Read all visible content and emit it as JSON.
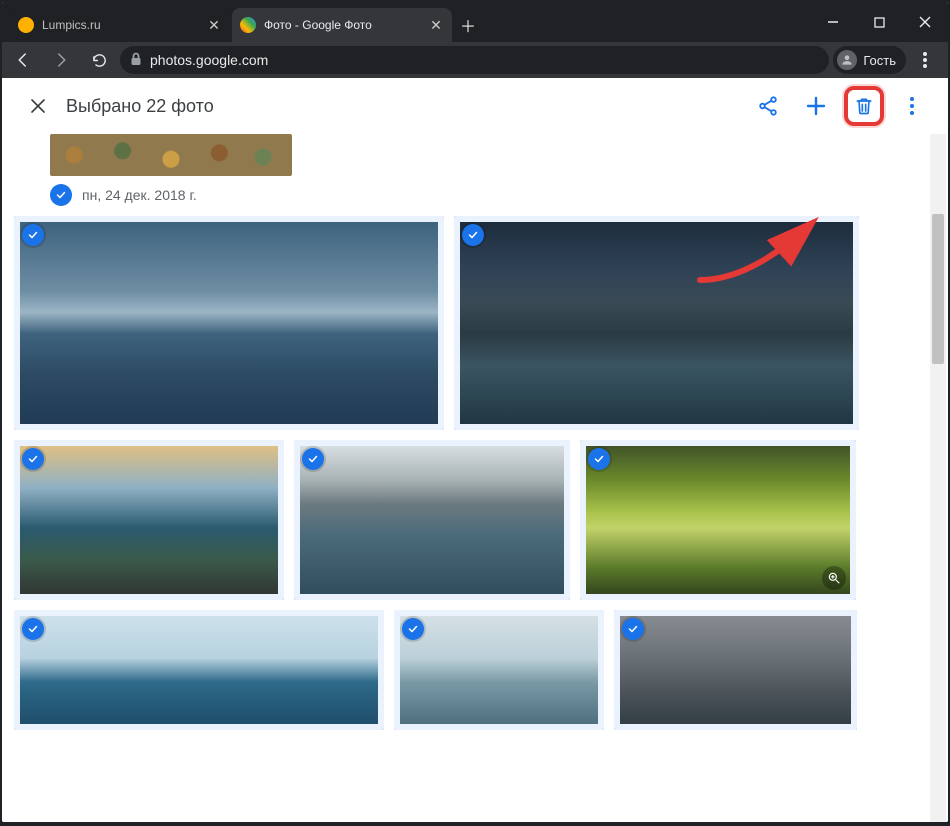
{
  "window": {
    "tabs": [
      {
        "title": "Lumpics.ru",
        "favicon_color": "#ffb000"
      },
      {
        "title": "Фото - Google Фото",
        "favicon_color": "#ea4335"
      }
    ],
    "url": "photos.google.com",
    "profile_label": "Гость"
  },
  "header": {
    "selection_text": "Выбрано 22 фото"
  },
  "date_group": {
    "label": "пн, 24 дек. 2018 г."
  },
  "icons": {
    "share": "share",
    "add": "add",
    "trash": "trash",
    "more": "more"
  }
}
